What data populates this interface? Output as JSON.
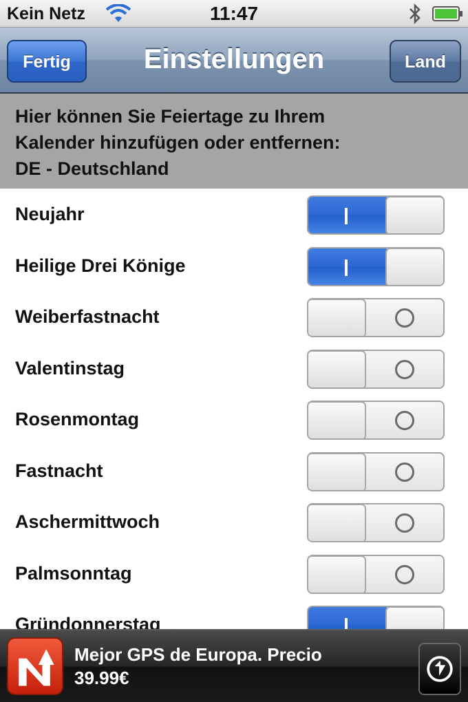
{
  "status_bar": {
    "carrier": "Kein Netz",
    "time": "11:47",
    "icons": [
      "wifi-icon",
      "bluetooth-icon",
      "battery-icon"
    ]
  },
  "nav_bar": {
    "title": "Einstellungen",
    "left_button": "Fertig",
    "right_button": "Land"
  },
  "info": {
    "line1": "Hier können Sie Feiertage zu Ihrem",
    "line2": "Kalender hinzufügen oder entfernen:",
    "line3": "DE - Deutschland"
  },
  "holidays": [
    {
      "label": "Neujahr",
      "on": true
    },
    {
      "label": "Heilige Drei Könige",
      "on": true
    },
    {
      "label": "Weiberfastnacht",
      "on": false
    },
    {
      "label": "Valentinstag",
      "on": false
    },
    {
      "label": "Rosenmontag",
      "on": false
    },
    {
      "label": "Fastnacht",
      "on": false
    },
    {
      "label": "Aschermittwoch",
      "on": false
    },
    {
      "label": "Palmsonntag",
      "on": false
    },
    {
      "label": "Gründonnerstag",
      "on": true
    }
  ],
  "ad": {
    "line1": "Mejor GPS de Europa. Precio",
    "line2": "39.99€",
    "icons": [
      "app-logo-icon",
      "download-icon"
    ]
  },
  "colors": {
    "accent_blue": "#2d67d3",
    "nav_bar": "#8ea3bd",
    "info_header": "#a5a5a5",
    "ad_logo_red": "#d93015"
  }
}
